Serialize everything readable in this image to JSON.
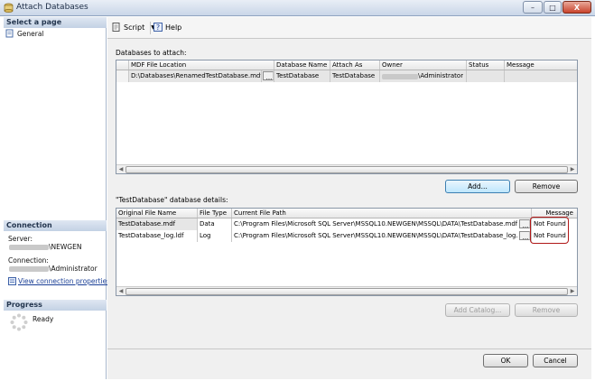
{
  "window": {
    "title": "Attach Databases",
    "minimize": "–",
    "maximize": "□",
    "close": "X"
  },
  "left": {
    "select_page": "Select a page",
    "pages": [
      {
        "label": "General"
      }
    ],
    "connection_header": "Connection",
    "server_label": "Server:",
    "server_value": "\\NEWGEN",
    "connection_label": "Connection:",
    "connection_value": "\\Administrator",
    "view_props": "View connection properties",
    "progress_header": "Progress",
    "progress_status": "Ready"
  },
  "toolbar": {
    "script": "Script",
    "help": "Help"
  },
  "attach": {
    "label": "Databases to attach:",
    "columns": [
      "MDF File Location",
      "Database Name",
      "Attach As",
      "Owner",
      "Status",
      "Message"
    ],
    "rows": [
      {
        "mdf": "D:\\Databases\\RenamedTestDatabase.mdf",
        "browse": "...",
        "dbname": "TestDatabase",
        "attach_as": "TestDatabase",
        "owner": "\\Administrator",
        "status": "",
        "message": ""
      }
    ],
    "add": "Add...",
    "remove": "Remove"
  },
  "details": {
    "label": "\"TestDatabase\" database details:",
    "columns": [
      "Original File Name",
      "File Type",
      "Current File Path",
      "Message"
    ],
    "rows": [
      {
        "name": "TestDatabase.mdf",
        "type": "Data",
        "path": "C:\\Program Files\\Microsoft SQL Server\\MSSQL10.NEWGEN\\MSSQL\\DATA\\TestDatabase.mdf",
        "browse": "...",
        "message": "Not Found"
      },
      {
        "name": "TestDatabase_log.ldf",
        "type": "Log",
        "path": "C:\\Program Files\\Microsoft SQL Server\\MSSQL10.NEWGEN\\MSSQL\\DATA\\TestDatabase_log.ldf",
        "browse": "...",
        "message": "Not Found"
      }
    ],
    "add_catalog": "Add Catalog...",
    "remove": "Remove"
  },
  "footer": {
    "ok": "OK",
    "cancel": "Cancel"
  },
  "colors": {
    "accent": "#1a3f96",
    "highlight": "#b01818"
  }
}
